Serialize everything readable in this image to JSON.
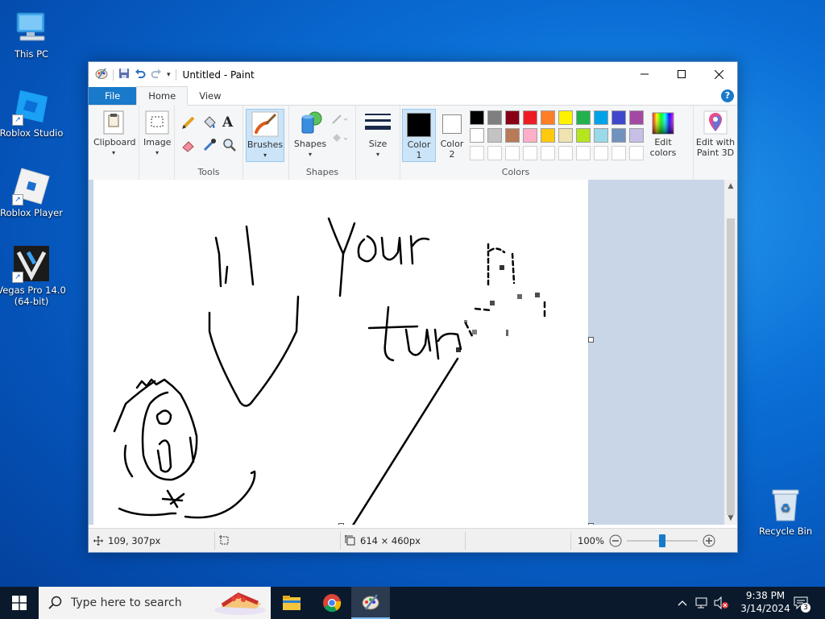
{
  "desktop": {
    "icons": [
      {
        "label": "This PC"
      },
      {
        "label": "Roblox Studio"
      },
      {
        "label": "Roblox Player"
      },
      {
        "label": "Vegas Pro 14.0 (64-bit)"
      },
      {
        "label": "Recycle Bin"
      }
    ]
  },
  "window": {
    "title": "Untitled - Paint",
    "tabs": [
      {
        "label": "File"
      },
      {
        "label": "Home"
      },
      {
        "label": "View"
      }
    ],
    "help_label": "?"
  },
  "ribbon": {
    "clipboard": {
      "label": "Clipboard"
    },
    "image": {
      "label": "Image"
    },
    "tools": {
      "label": "Tools",
      "text_tool": "A"
    },
    "brushes": {
      "label": "Brushes"
    },
    "shapes": {
      "button_label": "Shapes",
      "group_label": "Shapes"
    },
    "size": {
      "label": "Size"
    },
    "color1": {
      "label": "Color",
      "number": "1",
      "value": "#000000"
    },
    "color2": {
      "label": "Color",
      "number": "2",
      "value": "#ffffff"
    },
    "colors": {
      "label": "Colors",
      "palette_row1": [
        "#000000",
        "#7f7f7f",
        "#880015",
        "#ed1c24",
        "#ff7f27",
        "#fff200",
        "#22b14c",
        "#00a2e8",
        "#3f48cc",
        "#a349a4"
      ],
      "palette_row2": [
        "#ffffff",
        "#c3c3c3",
        "#b97a57",
        "#ffaec9",
        "#ffc90e",
        "#efe4b0",
        "#b5e61d",
        "#99d9ea",
        "#7092be",
        "#c8bfe7"
      ]
    },
    "edit_colors": {
      "line1": "Edit",
      "line2": "colors"
    },
    "paint3d": {
      "line1": "Edit with",
      "line2": "Paint 3D"
    }
  },
  "canvas": {
    "drawn_text": [
      "Your",
      "turn"
    ]
  },
  "statusbar": {
    "cursor_pos": "109, 307px",
    "canvas_size": "614 × 460px",
    "zoom": "100%",
    "zoom_level": 0.5
  },
  "taskbar": {
    "search_placeholder": "Type here to search",
    "time": "9:38 PM",
    "date": "3/14/2024",
    "notification_count": "3"
  }
}
